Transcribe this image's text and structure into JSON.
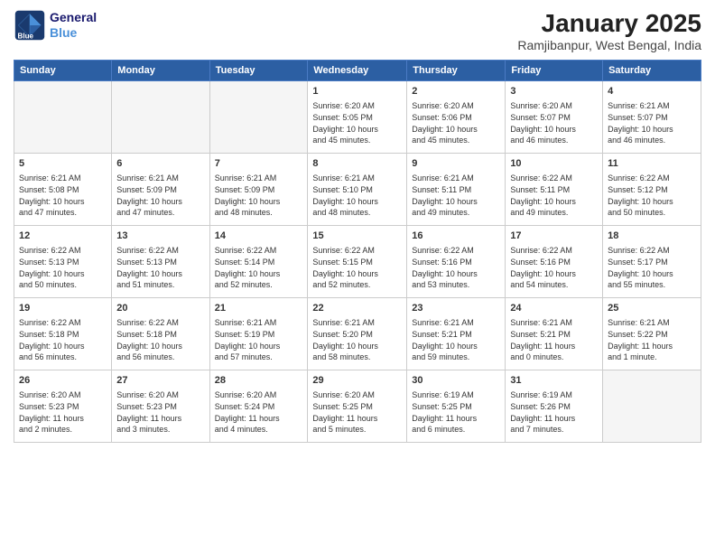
{
  "header": {
    "logo_line1": "General",
    "logo_line2": "Blue",
    "month": "January 2025",
    "location": "Ramjibanpur, West Bengal, India"
  },
  "weekdays": [
    "Sunday",
    "Monday",
    "Tuesday",
    "Wednesday",
    "Thursday",
    "Friday",
    "Saturday"
  ],
  "weeks": [
    [
      {
        "day": "",
        "info": ""
      },
      {
        "day": "",
        "info": ""
      },
      {
        "day": "",
        "info": ""
      },
      {
        "day": "1",
        "info": "Sunrise: 6:20 AM\nSunset: 5:05 PM\nDaylight: 10 hours\nand 45 minutes."
      },
      {
        "day": "2",
        "info": "Sunrise: 6:20 AM\nSunset: 5:06 PM\nDaylight: 10 hours\nand 45 minutes."
      },
      {
        "day": "3",
        "info": "Sunrise: 6:20 AM\nSunset: 5:07 PM\nDaylight: 10 hours\nand 46 minutes."
      },
      {
        "day": "4",
        "info": "Sunrise: 6:21 AM\nSunset: 5:07 PM\nDaylight: 10 hours\nand 46 minutes."
      }
    ],
    [
      {
        "day": "5",
        "info": "Sunrise: 6:21 AM\nSunset: 5:08 PM\nDaylight: 10 hours\nand 47 minutes."
      },
      {
        "day": "6",
        "info": "Sunrise: 6:21 AM\nSunset: 5:09 PM\nDaylight: 10 hours\nand 47 minutes."
      },
      {
        "day": "7",
        "info": "Sunrise: 6:21 AM\nSunset: 5:09 PM\nDaylight: 10 hours\nand 48 minutes."
      },
      {
        "day": "8",
        "info": "Sunrise: 6:21 AM\nSunset: 5:10 PM\nDaylight: 10 hours\nand 48 minutes."
      },
      {
        "day": "9",
        "info": "Sunrise: 6:21 AM\nSunset: 5:11 PM\nDaylight: 10 hours\nand 49 minutes."
      },
      {
        "day": "10",
        "info": "Sunrise: 6:22 AM\nSunset: 5:11 PM\nDaylight: 10 hours\nand 49 minutes."
      },
      {
        "day": "11",
        "info": "Sunrise: 6:22 AM\nSunset: 5:12 PM\nDaylight: 10 hours\nand 50 minutes."
      }
    ],
    [
      {
        "day": "12",
        "info": "Sunrise: 6:22 AM\nSunset: 5:13 PM\nDaylight: 10 hours\nand 50 minutes."
      },
      {
        "day": "13",
        "info": "Sunrise: 6:22 AM\nSunset: 5:13 PM\nDaylight: 10 hours\nand 51 minutes."
      },
      {
        "day": "14",
        "info": "Sunrise: 6:22 AM\nSunset: 5:14 PM\nDaylight: 10 hours\nand 52 minutes."
      },
      {
        "day": "15",
        "info": "Sunrise: 6:22 AM\nSunset: 5:15 PM\nDaylight: 10 hours\nand 52 minutes."
      },
      {
        "day": "16",
        "info": "Sunrise: 6:22 AM\nSunset: 5:16 PM\nDaylight: 10 hours\nand 53 minutes."
      },
      {
        "day": "17",
        "info": "Sunrise: 6:22 AM\nSunset: 5:16 PM\nDaylight: 10 hours\nand 54 minutes."
      },
      {
        "day": "18",
        "info": "Sunrise: 6:22 AM\nSunset: 5:17 PM\nDaylight: 10 hours\nand 55 minutes."
      }
    ],
    [
      {
        "day": "19",
        "info": "Sunrise: 6:22 AM\nSunset: 5:18 PM\nDaylight: 10 hours\nand 56 minutes."
      },
      {
        "day": "20",
        "info": "Sunrise: 6:22 AM\nSunset: 5:18 PM\nDaylight: 10 hours\nand 56 minutes."
      },
      {
        "day": "21",
        "info": "Sunrise: 6:21 AM\nSunset: 5:19 PM\nDaylight: 10 hours\nand 57 minutes."
      },
      {
        "day": "22",
        "info": "Sunrise: 6:21 AM\nSunset: 5:20 PM\nDaylight: 10 hours\nand 58 minutes."
      },
      {
        "day": "23",
        "info": "Sunrise: 6:21 AM\nSunset: 5:21 PM\nDaylight: 10 hours\nand 59 minutes."
      },
      {
        "day": "24",
        "info": "Sunrise: 6:21 AM\nSunset: 5:21 PM\nDaylight: 11 hours\nand 0 minutes."
      },
      {
        "day": "25",
        "info": "Sunrise: 6:21 AM\nSunset: 5:22 PM\nDaylight: 11 hours\nand 1 minute."
      }
    ],
    [
      {
        "day": "26",
        "info": "Sunrise: 6:20 AM\nSunset: 5:23 PM\nDaylight: 11 hours\nand 2 minutes."
      },
      {
        "day": "27",
        "info": "Sunrise: 6:20 AM\nSunset: 5:23 PM\nDaylight: 11 hours\nand 3 minutes."
      },
      {
        "day": "28",
        "info": "Sunrise: 6:20 AM\nSunset: 5:24 PM\nDaylight: 11 hours\nand 4 minutes."
      },
      {
        "day": "29",
        "info": "Sunrise: 6:20 AM\nSunset: 5:25 PM\nDaylight: 11 hours\nand 5 minutes."
      },
      {
        "day": "30",
        "info": "Sunrise: 6:19 AM\nSunset: 5:25 PM\nDaylight: 11 hours\nand 6 minutes."
      },
      {
        "day": "31",
        "info": "Sunrise: 6:19 AM\nSunset: 5:26 PM\nDaylight: 11 hours\nand 7 minutes."
      },
      {
        "day": "",
        "info": ""
      }
    ]
  ]
}
